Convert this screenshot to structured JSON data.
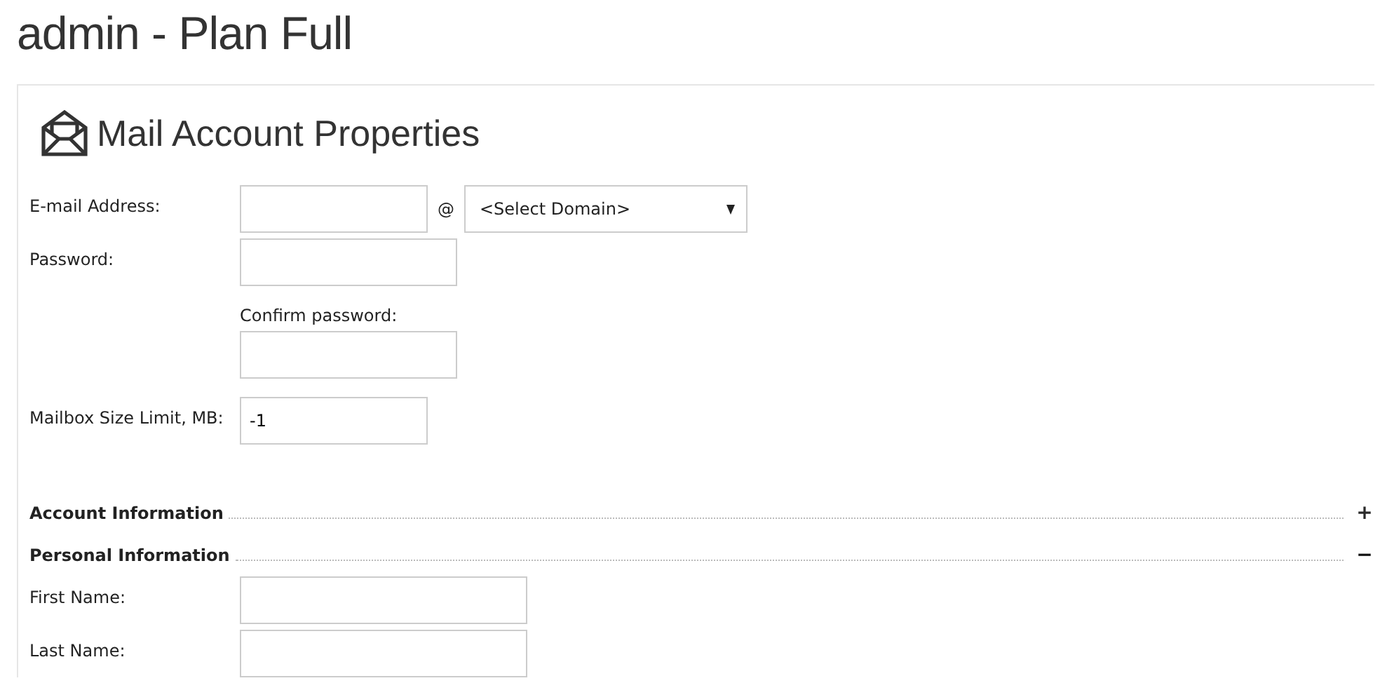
{
  "page_title": "admin - Plan Full",
  "panel": {
    "title": "Mail Account Properties",
    "email": {
      "label": "E-mail Address:",
      "at": "@",
      "domain": "<Select Domain>"
    },
    "password": {
      "label": "Password:"
    },
    "confirm_password": {
      "label": "Confirm password:"
    },
    "mailbox_size": {
      "label": "Mailbox Size Limit, MB:",
      "value": "-1"
    },
    "sections": [
      {
        "title": "Account Information",
        "toggle": "+",
        "expanded": false
      },
      {
        "title": "Personal Information",
        "toggle": "−",
        "expanded": true,
        "fields": [
          {
            "label": "First Name:"
          },
          {
            "label": "Last Name:"
          }
        ]
      }
    ]
  }
}
